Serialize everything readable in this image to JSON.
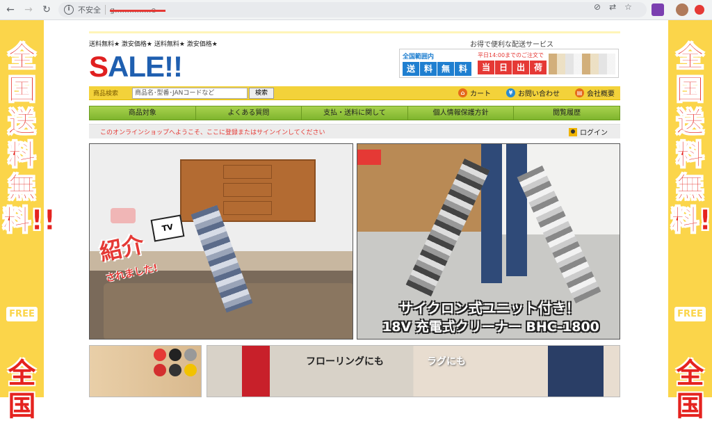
{
  "browser": {
    "security_label": "不安全",
    "url_text": "g...............e",
    "nav": {
      "back": "←",
      "forward": "→",
      "reload": "↻"
    }
  },
  "side_banner": {
    "headline": "全国送料無料!!",
    "free_label": "FREE",
    "headline_bottom": "全国"
  },
  "header": {
    "tagline": "送料無料★ 激安価格★ 送料無料★ 激安価格★",
    "service_title": "お得で便利な配送サービス",
    "logo_first": "S",
    "logo_rest": "ALE!!",
    "promo": {
      "left_top": "全国範囲内",
      "left_chars": [
        "送",
        "料",
        "無",
        "料"
      ],
      "right_top": "平日14:00までのご注文で",
      "right_chars": [
        "当",
        "日",
        "出",
        "荷"
      ]
    }
  },
  "search": {
    "label": "商品検索",
    "placeholder": "商品名･型番･JANコードなど",
    "button": "検索",
    "links": [
      {
        "label": "カート",
        "icon": "cart-icon",
        "color": "#e46a1a"
      },
      {
        "label": "お問い合わせ",
        "icon": "yen-icon",
        "color": "#2a8ad0"
      },
      {
        "label": "会社概要",
        "icon": "company-icon",
        "color": "#e46a1a"
      }
    ]
  },
  "nav": {
    "items": [
      "商品対象",
      "よくある質問",
      "支払・送料に関して",
      "個人情報保護方針",
      "閲覧履歴"
    ]
  },
  "welcome": {
    "message": "このオンラインショップへようこそ、ここに登録またはサインインしてください",
    "login": "ログイン"
  },
  "hero1": {
    "tv_label": "TV",
    "intro": "紹介",
    "intro_sub": "されました!"
  },
  "hero2": {
    "caption1": "サイクロン式ユニット付き！",
    "caption2": "18V 充電式クリーナー BHC-1800"
  },
  "tiles": {
    "flooring": "フローリングにも",
    "rug": "ラグにも"
  },
  "colors": {
    "accent_yellow": "#fbd54a",
    "sale_red": "#e02020",
    "sale_blue": "#1f5fb0",
    "nav_green": "#8fc23a"
  }
}
